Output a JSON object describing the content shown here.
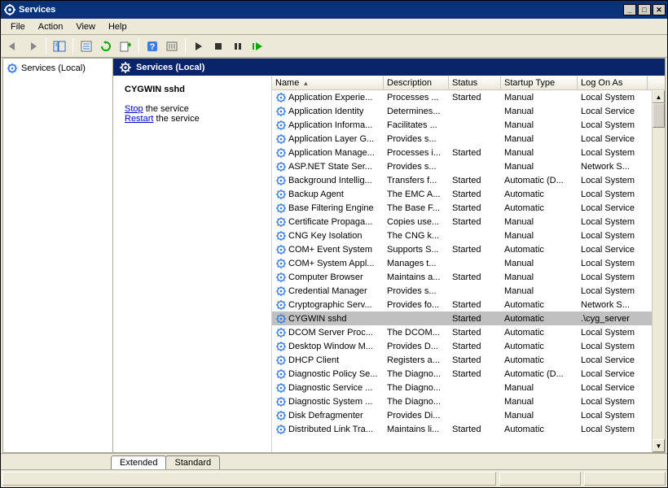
{
  "window": {
    "title": "Services"
  },
  "menubar": [
    "File",
    "Action",
    "View",
    "Help"
  ],
  "tree": {
    "root": "Services (Local)"
  },
  "header": {
    "title": "Services (Local)"
  },
  "detail": {
    "selected_name": "CYGWIN sshd",
    "stop_link": "Stop",
    "stop_suffix": " the service",
    "restart_link": "Restart",
    "restart_suffix": " the service"
  },
  "columns": {
    "name": "Name",
    "description": "Description",
    "status": "Status",
    "startup": "Startup Type",
    "logon": "Log On As"
  },
  "tabs": {
    "extended": "Extended",
    "standard": "Standard"
  },
  "services": [
    {
      "name": "Application Experie...",
      "desc": "Processes ...",
      "status": "Started",
      "startup": "Manual",
      "logon": "Local System",
      "selected": false
    },
    {
      "name": "Application Identity",
      "desc": "Determines...",
      "status": "",
      "startup": "Manual",
      "logon": "Local Service",
      "selected": false
    },
    {
      "name": "Application Informa...",
      "desc": "Facilitates ...",
      "status": "",
      "startup": "Manual",
      "logon": "Local System",
      "selected": false
    },
    {
      "name": "Application Layer G...",
      "desc": "Provides s...",
      "status": "",
      "startup": "Manual",
      "logon": "Local Service",
      "selected": false
    },
    {
      "name": "Application Manage...",
      "desc": "Processes i...",
      "status": "Started",
      "startup": "Manual",
      "logon": "Local System",
      "selected": false
    },
    {
      "name": "ASP.NET State Ser...",
      "desc": "Provides s...",
      "status": "",
      "startup": "Manual",
      "logon": "Network S...",
      "selected": false
    },
    {
      "name": "Background Intellig...",
      "desc": "Transfers f...",
      "status": "Started",
      "startup": "Automatic (D...",
      "logon": "Local System",
      "selected": false
    },
    {
      "name": "Backup Agent",
      "desc": "The EMC A...",
      "status": "Started",
      "startup": "Automatic",
      "logon": "Local System",
      "selected": false
    },
    {
      "name": "Base Filtering Engine",
      "desc": "The Base F...",
      "status": "Started",
      "startup": "Automatic",
      "logon": "Local Service",
      "selected": false
    },
    {
      "name": "Certificate Propaga...",
      "desc": "Copies use...",
      "status": "Started",
      "startup": "Manual",
      "logon": "Local System",
      "selected": false
    },
    {
      "name": "CNG Key Isolation",
      "desc": "The CNG k...",
      "status": "",
      "startup": "Manual",
      "logon": "Local System",
      "selected": false
    },
    {
      "name": "COM+ Event System",
      "desc": "Supports S...",
      "status": "Started",
      "startup": "Automatic",
      "logon": "Local Service",
      "selected": false
    },
    {
      "name": "COM+ System Appl...",
      "desc": "Manages t...",
      "status": "",
      "startup": "Manual",
      "logon": "Local System",
      "selected": false
    },
    {
      "name": "Computer Browser",
      "desc": "Maintains a...",
      "status": "Started",
      "startup": "Manual",
      "logon": "Local System",
      "selected": false
    },
    {
      "name": "Credential Manager",
      "desc": "Provides s...",
      "status": "",
      "startup": "Manual",
      "logon": "Local System",
      "selected": false
    },
    {
      "name": "Cryptographic Serv...",
      "desc": "Provides fo...",
      "status": "Started",
      "startup": "Automatic",
      "logon": "Network S...",
      "selected": false
    },
    {
      "name": "CYGWIN sshd",
      "desc": "",
      "status": "Started",
      "startup": "Automatic",
      "logon": ".\\cyg_server",
      "selected": true
    },
    {
      "name": "DCOM Server Proc...",
      "desc": "The DCOM...",
      "status": "Started",
      "startup": "Automatic",
      "logon": "Local System",
      "selected": false
    },
    {
      "name": "Desktop Window M...",
      "desc": "Provides D...",
      "status": "Started",
      "startup": "Automatic",
      "logon": "Local System",
      "selected": false
    },
    {
      "name": "DHCP Client",
      "desc": "Registers a...",
      "status": "Started",
      "startup": "Automatic",
      "logon": "Local Service",
      "selected": false
    },
    {
      "name": "Diagnostic Policy Se...",
      "desc": "The Diagno...",
      "status": "Started",
      "startup": "Automatic (D...",
      "logon": "Local Service",
      "selected": false
    },
    {
      "name": "Diagnostic Service ...",
      "desc": "The Diagno...",
      "status": "",
      "startup": "Manual",
      "logon": "Local Service",
      "selected": false
    },
    {
      "name": "Diagnostic System ...",
      "desc": "The Diagno...",
      "status": "",
      "startup": "Manual",
      "logon": "Local System",
      "selected": false
    },
    {
      "name": "Disk Defragmenter",
      "desc": "Provides Di...",
      "status": "",
      "startup": "Manual",
      "logon": "Local System",
      "selected": false
    },
    {
      "name": "Distributed Link Tra...",
      "desc": "Maintains li...",
      "status": "Started",
      "startup": "Automatic",
      "logon": "Local System",
      "selected": false
    }
  ]
}
